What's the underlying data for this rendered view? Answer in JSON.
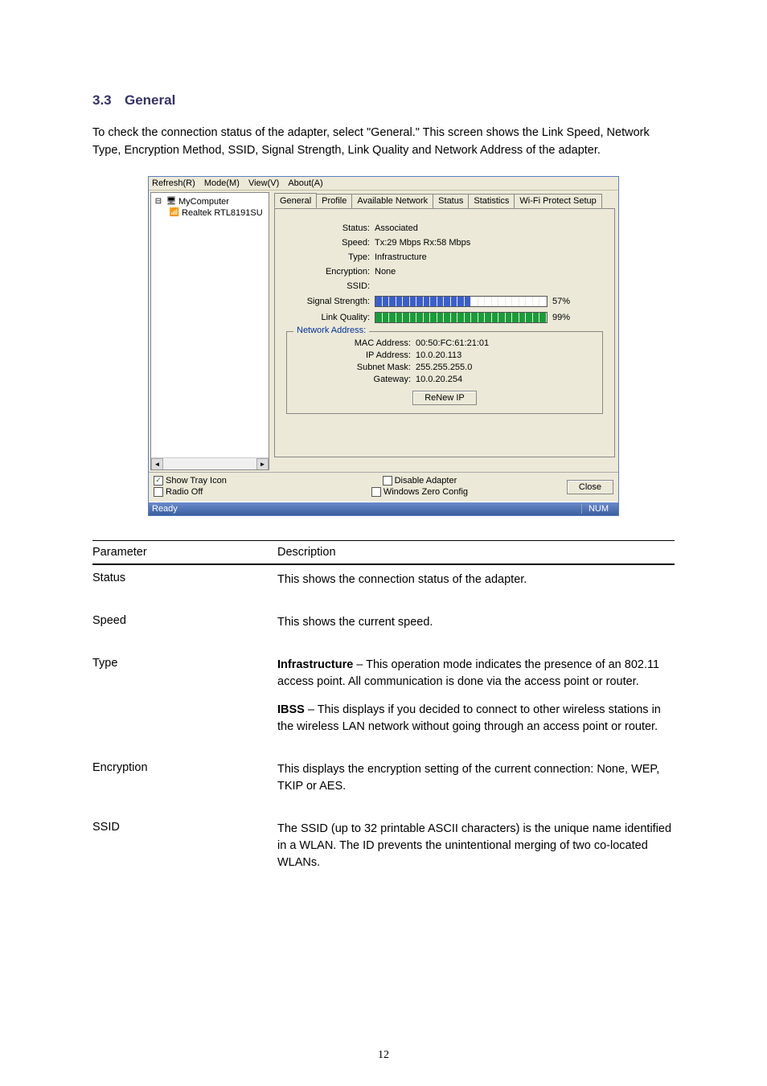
{
  "heading": {
    "num": "3.3",
    "title": "General"
  },
  "intro": "To check the connection status of the adapter, select \"General.\" This screen shows the Link Speed, Network Type, Encryption Method, SSID, Signal Strength, Link Quality and Network Address of the adapter.",
  "win": {
    "menu": {
      "refresh": "Refresh(R)",
      "mode": "Mode(M)",
      "view": "View(V)",
      "about": "About(A)"
    },
    "tree": {
      "root": "MyComputer",
      "child": "Realtek RTL8191SU"
    },
    "tabs": [
      "General",
      "Profile",
      "Available Network",
      "Status",
      "Statistics",
      "Wi-Fi Protect Setup"
    ],
    "info": {
      "status_label": "Status:",
      "status_val": "Associated",
      "speed_label": "Speed:",
      "speed_val": "Tx:29 Mbps Rx:58 Mbps",
      "type_label": "Type:",
      "type_val": "Infrastructure",
      "enc_label": "Encryption:",
      "enc_val": "None",
      "ssid_label": "SSID:",
      "ssid_val": "",
      "sig_label": "Signal Strength:",
      "sig_pct": "57%",
      "lq_label": "Link Quality:",
      "lq_pct": "99%"
    },
    "na": {
      "legend": "Network Address:",
      "mac_label": "MAC Address:",
      "mac_val": "00:50:FC:61:21:01",
      "ip_label": "IP Address:",
      "ip_val": "10.0.20.113",
      "subnet_label": "Subnet Mask:",
      "subnet_val": "255.255.255.0",
      "gw_label": "Gateway:",
      "gw_val": "10.0.20.254",
      "renew_btn": "ReNew IP"
    },
    "bottom": {
      "show_tray": "Show Tray Icon",
      "radio_off": "Radio Off",
      "disable": "Disable Adapter",
      "wzc": "Windows Zero Config",
      "close": "Close"
    },
    "statusbar": {
      "ready": "Ready",
      "num": "NUM"
    }
  },
  "table": {
    "h1": "Parameter",
    "h2": "Description",
    "rows": {
      "status": {
        "p": "Status",
        "d": "This shows the connection status of the adapter."
      },
      "speed": {
        "p": "Speed",
        "d": "This shows the current speed."
      },
      "type": {
        "p": "Type",
        "d1a": "Infrastructure",
        "d1b": " – This operation mode indicates the presence of an 802.11 access point. All communication is done via the access point or router.",
        "d2a": "IBSS",
        "d2b": " – This displays if you decided to connect to other wireless stations in the wireless LAN network without going through an access point or router."
      },
      "enc": {
        "p": "Encryption",
        "d": "This displays the encryption setting of the current connection: None, WEP, TKIP or AES."
      },
      "ssid": {
        "p": "SSID",
        "d": "The SSID (up to 32 printable ASCII characters) is the unique name identified in a WLAN. The ID prevents the unintentional merging of two co-located WLANs."
      }
    }
  },
  "page_num": "12"
}
